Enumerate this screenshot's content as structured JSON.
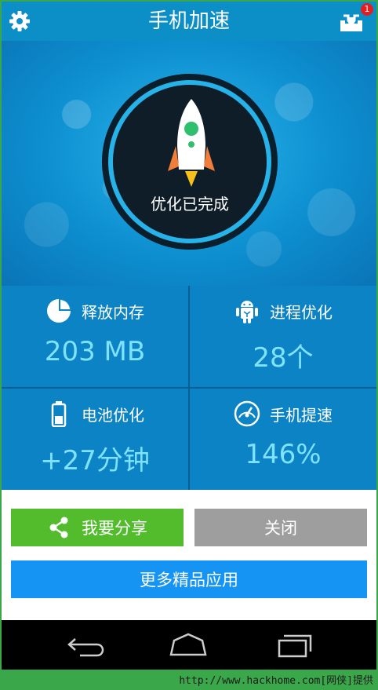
{
  "header": {
    "title": "手机加速",
    "badge_count": "1"
  },
  "hero": {
    "status_text": "优化已完成"
  },
  "stats": [
    {
      "label": "释放内存",
      "value": "203 MB",
      "icon": "pie-chart-icon"
    },
    {
      "label": "进程优化",
      "value": "28个",
      "icon": "android-icon"
    },
    {
      "label": "电池优化",
      "value": "+27分钟",
      "icon": "battery-icon"
    },
    {
      "label": "手机提速",
      "value": "146%",
      "icon": "speedometer-icon"
    }
  ],
  "buttons": {
    "share": "我要分享",
    "close": "关闭",
    "more": "更多精品应用"
  },
  "watermark": "http://www.hackhome.com[网侠]提供",
  "colors": {
    "header": "#0b8fc6",
    "stats_bg": "#0c83c5",
    "value_text": "#7fe3ff",
    "share_btn": "#52bc2d",
    "close_btn": "#9e9e9e",
    "more_btn": "#1594f4",
    "frame": "#3aa84a"
  }
}
